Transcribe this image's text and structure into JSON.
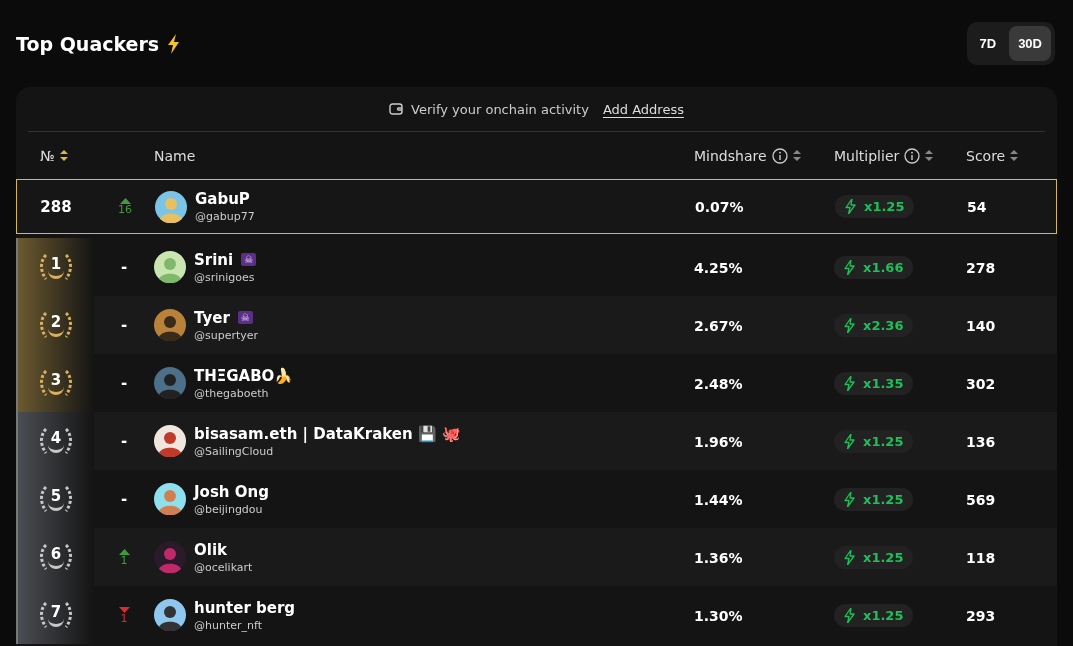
{
  "title": "Top Quackers",
  "periods": [
    {
      "label": "7D",
      "selected": false
    },
    {
      "label": "30D",
      "selected": true
    }
  ],
  "verify": {
    "text": "Verify your onchain activity",
    "link": "Add Address"
  },
  "columns": [
    {
      "label": "№",
      "info": false,
      "sortable": true,
      "sorted": true
    },
    {
      "label": "Name",
      "info": false,
      "sortable": false
    },
    {
      "label": "Mindshare",
      "info": true,
      "sortable": true,
      "sorted": false
    },
    {
      "label": "Multiplier",
      "info": true,
      "sortable": true,
      "sorted": false
    },
    {
      "label": "Score",
      "info": false,
      "sortable": true,
      "sorted": false
    }
  ],
  "current_user": {
    "rank": "288",
    "change": {
      "kind": "up",
      "amount": "16"
    },
    "name": "GabuP",
    "handle": "@gabup77",
    "mindshare": "0.07%",
    "multiplier": "x1.25",
    "score": "54"
  },
  "rows": [
    {
      "rank": "1",
      "kind": "gold",
      "change": {
        "kind": "none",
        "amount": "-"
      },
      "name": "Srini",
      "badge": "☠",
      "handle": "@srinigoes",
      "mindshare": "4.25%",
      "multiplier": "x1.66",
      "score": "278"
    },
    {
      "rank": "2",
      "kind": "gold",
      "change": {
        "kind": "none",
        "amount": "-"
      },
      "name": "Tyer",
      "badge": "☠",
      "handle": "@supertyer",
      "mindshare": "2.67%",
      "multiplier": "x2.36",
      "score": "140"
    },
    {
      "rank": "3",
      "kind": "gold",
      "change": {
        "kind": "none",
        "amount": "-"
      },
      "name": "THΞGABO🍌",
      "handle": "@thegaboeth",
      "mindshare": "2.48%",
      "multiplier": "x1.35",
      "score": "302"
    },
    {
      "rank": "4",
      "kind": "silver",
      "change": {
        "kind": "none",
        "amount": "-"
      },
      "name": "bisasam.eth | DataKraken 💾 🐙",
      "handle": "@SailingCloud",
      "mindshare": "1.96%",
      "multiplier": "x1.25",
      "score": "136"
    },
    {
      "rank": "5",
      "kind": "silver",
      "change": {
        "kind": "none",
        "amount": "-"
      },
      "name": "Josh Ong",
      "handle": "@beijingdou",
      "mindshare": "1.44%",
      "multiplier": "x1.25",
      "score": "569"
    },
    {
      "rank": "6",
      "kind": "silver",
      "change": {
        "kind": "up",
        "amount": "1"
      },
      "name": "Olik",
      "handle": "@ocelikart",
      "mindshare": "1.36%",
      "multiplier": "x1.25",
      "score": "118"
    },
    {
      "rank": "7",
      "kind": "silver",
      "change": {
        "kind": "down",
        "amount": "1"
      },
      "name": "hunter berg",
      "handle": "@hunter_nft",
      "mindshare": "1.30%",
      "multiplier": "x1.25",
      "score": "293"
    }
  ]
}
